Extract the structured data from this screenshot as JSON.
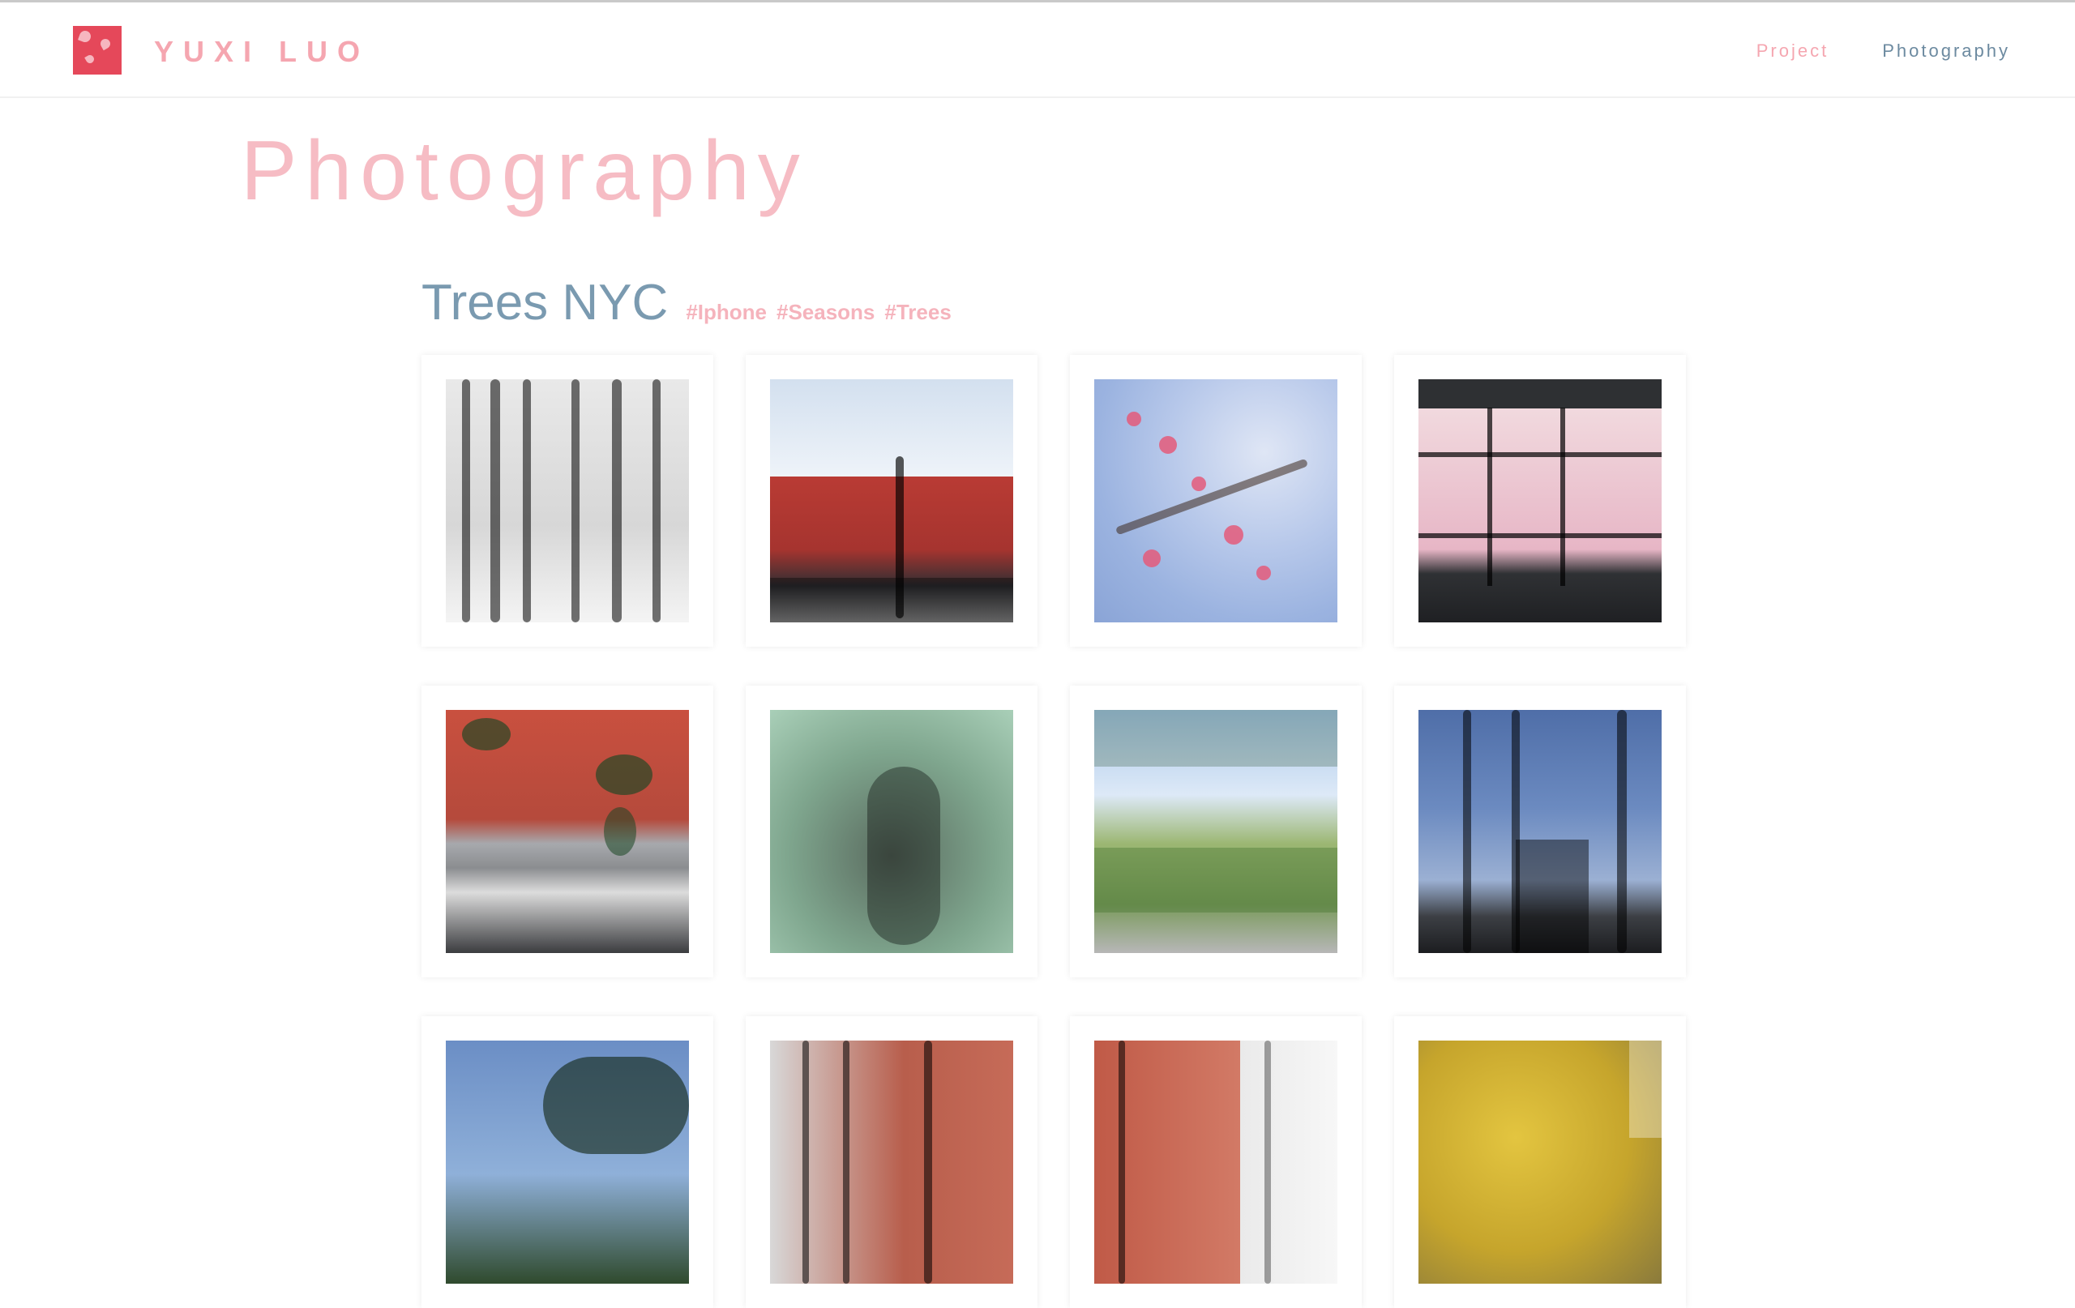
{
  "site": {
    "brand": "YUXI LUO",
    "nav": {
      "project": "Project",
      "photography": "Photography"
    },
    "colors": {
      "brand_pink": "#f5a6b0",
      "title_pink": "#f6bcc4",
      "album_blue": "#7a9ab0",
      "logo_red": "#e5485a"
    }
  },
  "page": {
    "title": "Photography"
  },
  "album": {
    "title": "Trees NYC",
    "tags": [
      "#Iphone",
      "#Seasons",
      "#Trees"
    ],
    "photos": [
      {
        "name": "photo-snow-trees"
      },
      {
        "name": "photo-street-lamp"
      },
      {
        "name": "photo-cherry-blossom"
      },
      {
        "name": "photo-window-blossom"
      },
      {
        "name": "photo-red-wall"
      },
      {
        "name": "photo-shadow"
      },
      {
        "name": "photo-park"
      },
      {
        "name": "photo-bare-trees"
      },
      {
        "name": "photo-sky-branches"
      },
      {
        "name": "photo-building-branches"
      },
      {
        "name": "photo-red-building"
      },
      {
        "name": "photo-yellow-tree"
      }
    ]
  }
}
